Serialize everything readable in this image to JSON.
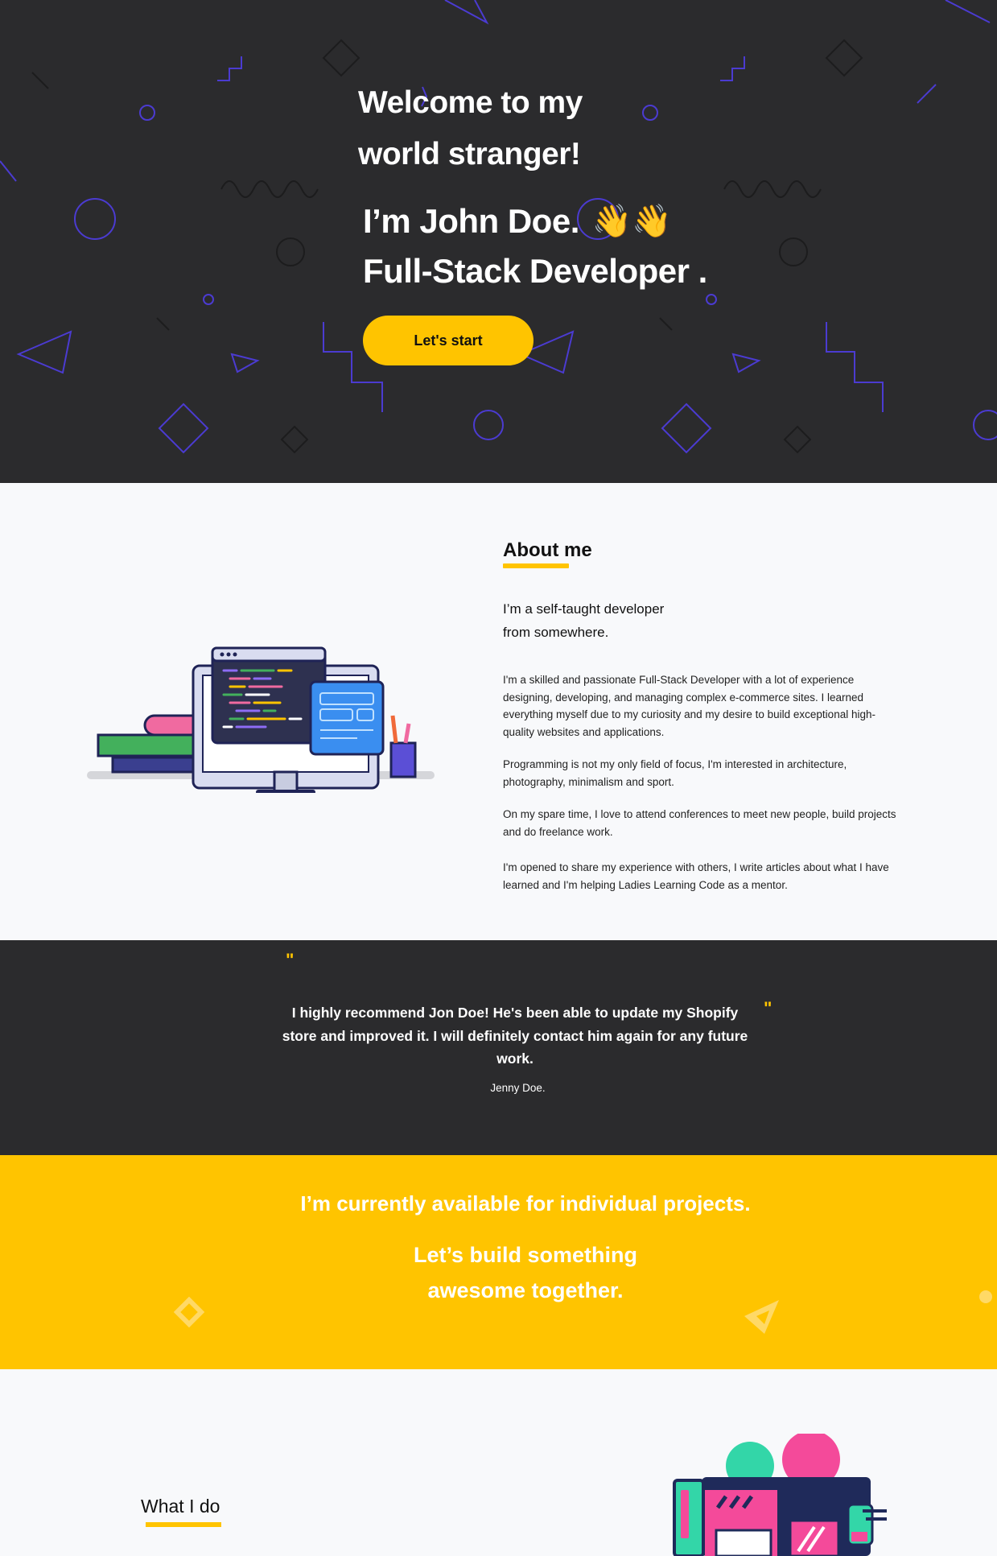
{
  "hero": {
    "welcome_line1": "Welcome to my",
    "welcome_line2": "world stranger!",
    "name_line": "I’m John Doe.",
    "wave_emoji": "👋👋",
    "role_line": "Full-Stack Developer .",
    "cta_label": "Let's start"
  },
  "about": {
    "title": "About me",
    "subtitle_line1": "I’m a self-taught developer",
    "subtitle_line2": "from somewhere.",
    "paragraphs": [
      "I'm a skilled and passionate Full-Stack Developer with a lot of experience designing, developing, and managing complex e-commerce sites. I learned everything myself due to my curiosity and my desire to build exceptional high-quality websites and applications.",
      "Programming is not my only field of focus, I'm interested in architecture, photography, minimalism and sport.",
      "On my spare time, I love to attend conferences to meet new people, build projects and do freelance work.",
      "I'm opened to share my experience with others, I write articles about what I have learned and I'm helping Ladies Learning Code as a mentor."
    ]
  },
  "testimonial": {
    "open_quote": "\"",
    "close_quote": "\"",
    "text": "I highly recommend Jon Doe! He's been able to update my Shopify store and improved it. I will definitely contact him again for any future work.",
    "author": "Jenny Doe."
  },
  "available": {
    "line": "I’m currently available for individual projects.",
    "build_line1": "Let’s build something",
    "build_line2": "awesome together."
  },
  "whatido": {
    "title": "What I do"
  },
  "colors": {
    "accent": "#ffc400",
    "dark_bg": "#2b2b2d",
    "light_bg": "#f8f9fb",
    "shape_purple": "#4b3bd1"
  },
  "icons": [
    "developer-workstation-illustration",
    "design-tools-illustration",
    "quote-mark-icon",
    "wave-emoji"
  ]
}
